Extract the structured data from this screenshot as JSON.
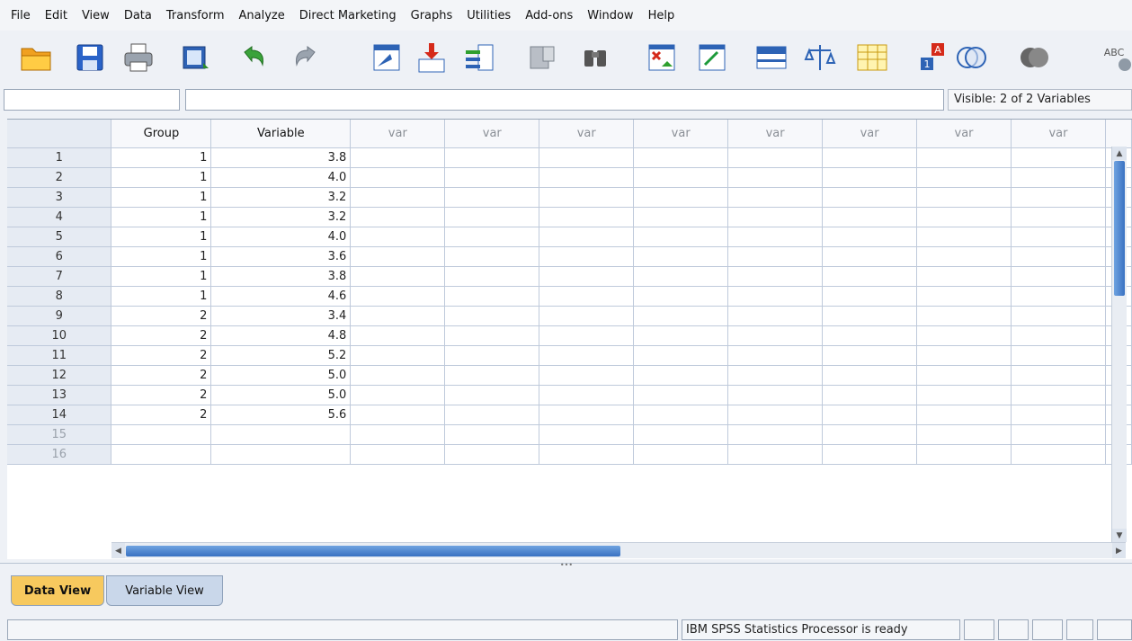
{
  "menu": [
    "File",
    "Edit",
    "View",
    "Data",
    "Transform",
    "Analyze",
    "Direct Marketing",
    "Graphs",
    "Utilities",
    "Add-ons",
    "Window",
    "Help"
  ],
  "toolbar_icons": [
    "open-folder-icon",
    "save-icon",
    "print-icon",
    "dialog-recall-icon",
    "undo-icon",
    "redo-icon",
    "go-to-case-icon",
    "go-to-variable-icon",
    "variables-icon",
    "run-descriptive-icon",
    "find-icon",
    "insert-cases-icon",
    "insert-variable-icon",
    "split-file-icon",
    "weight-cases-icon",
    "select-cases-icon",
    "value-labels-icon",
    "use-variable-sets-icon",
    "show-all-variables-icon",
    "spell-check-icon"
  ],
  "editor": {
    "cell_name": "",
    "cell_value": "",
    "visible_label": "Visible: 2 of 2 Variables"
  },
  "columns": [
    "Group",
    "Variable",
    "var",
    "var",
    "var",
    "var",
    "var",
    "var",
    "var",
    "var"
  ],
  "rows": [
    {
      "n": "1",
      "group": "1",
      "variable": "3.8"
    },
    {
      "n": "2",
      "group": "1",
      "variable": "4.0"
    },
    {
      "n": "3",
      "group": "1",
      "variable": "3.2"
    },
    {
      "n": "4",
      "group": "1",
      "variable": "3.2"
    },
    {
      "n": "5",
      "group": "1",
      "variable": "4.0"
    },
    {
      "n": "6",
      "group": "1",
      "variable": "3.6"
    },
    {
      "n": "7",
      "group": "1",
      "variable": "3.8"
    },
    {
      "n": "8",
      "group": "1",
      "variable": "4.6"
    },
    {
      "n": "9",
      "group": "2",
      "variable": "3.4"
    },
    {
      "n": "10",
      "group": "2",
      "variable": "4.8"
    },
    {
      "n": "11",
      "group": "2",
      "variable": "5.2"
    },
    {
      "n": "12",
      "group": "2",
      "variable": "5.0"
    },
    {
      "n": "13",
      "group": "2",
      "variable": "5.0"
    },
    {
      "n": "14",
      "group": "2",
      "variable": "5.6"
    },
    {
      "n": "15",
      "group": "",
      "variable": ""
    },
    {
      "n": "16",
      "group": "",
      "variable": ""
    }
  ],
  "tabs": {
    "data_view": "Data View",
    "variable_view": "Variable View",
    "active": "data_view"
  },
  "status": {
    "message": "IBM SPSS Statistics Processor is ready"
  },
  "colors": {
    "active_tab": "#f7c95e",
    "inactive_tab": "#c9d7ea",
    "scroll_thumb": "#3a72c2"
  }
}
